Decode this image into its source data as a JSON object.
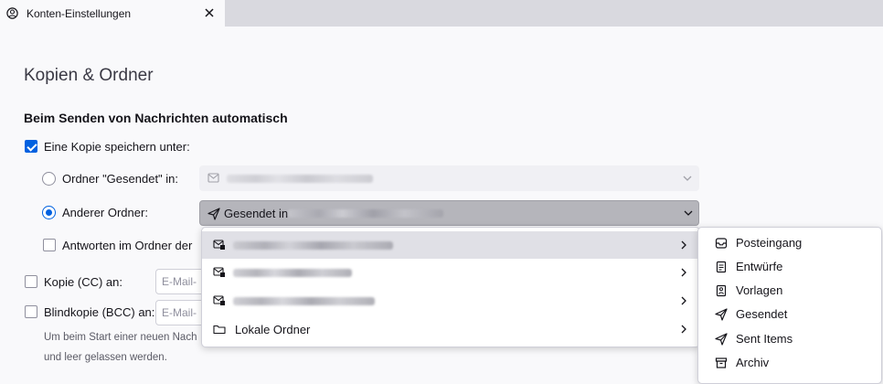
{
  "tab": {
    "title": "Konten-Einstellungen"
  },
  "page": {
    "title": "Kopien & Ordner",
    "section_title": "Beim Senden von Nachrichten automatisch",
    "save_copy_label": "Eine Kopie speichern unter:",
    "radio_sent_label": "Ordner \"Gesendet\" in:",
    "radio_other_label": "Anderer Ordner:",
    "selected_folder_label": "Gesendet in",
    "reply_label": "Antworten im Ordner der",
    "cc_label": "Kopie (CC) an:",
    "bcc_label": "Blindkopie (BCC) an:",
    "cc_placeholder": "E-Mail-",
    "bcc_placeholder": "E-Mail-",
    "hint_line1": "Um beim Start einer neuen Nach",
    "hint_line2": "und leer gelassen werden."
  },
  "state": {
    "save_copy_checked": true,
    "radio_sent_checked": false,
    "radio_other_checked": true,
    "reply_checked": false,
    "cc_checked": false,
    "bcc_checked": false
  },
  "menu": {
    "items": [
      {
        "label": "",
        "icon": "account-icon",
        "highlighted": true
      },
      {
        "label": "",
        "icon": "account-icon",
        "highlighted": false
      },
      {
        "label": "",
        "icon": "account-icon",
        "highlighted": false
      },
      {
        "label": "Lokale Ordner",
        "icon": "folder-icon",
        "highlighted": false
      }
    ]
  },
  "submenu": {
    "items": [
      {
        "label": "Posteingang",
        "icon": "inbox-icon"
      },
      {
        "label": "Entwürfe",
        "icon": "drafts-icon"
      },
      {
        "label": "Vorlagen",
        "icon": "templates-icon"
      },
      {
        "label": "Gesendet",
        "icon": "sent-icon"
      },
      {
        "label": "Sent Items",
        "icon": "sent-icon"
      },
      {
        "label": "Archiv",
        "icon": "archive-icon"
      }
    ]
  },
  "colors": {
    "accent": "#0061e0",
    "background": "#f9f9fb",
    "tabstrip": "#d9d9df"
  }
}
